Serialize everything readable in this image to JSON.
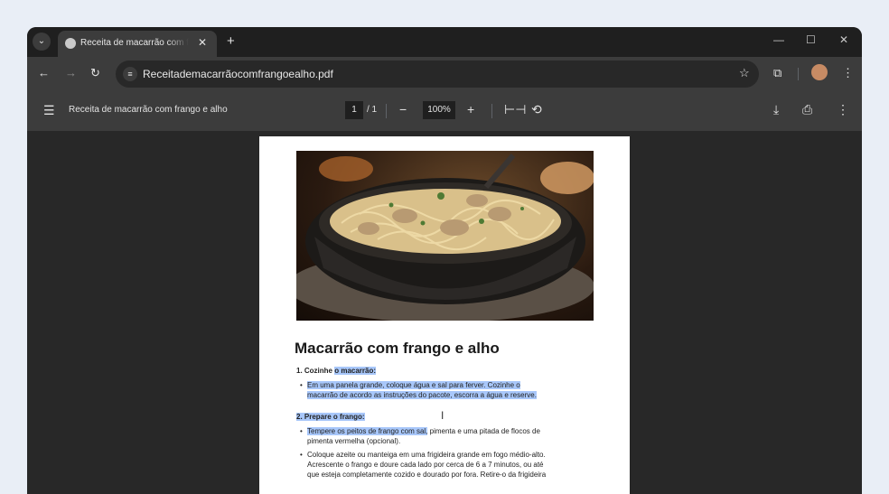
{
  "tab": {
    "title": "Receita de macarrão com frango e alho"
  },
  "address": {
    "url": "Receitademacarrãocomfrangoealho.pdf"
  },
  "pdf_toolbar": {
    "doc_title": "Receita de macarrão com frango e alho",
    "page_current": "1",
    "page_total": "/ 1",
    "zoom": "100%"
  },
  "document": {
    "heading": "Macarrão com frango e alho",
    "step1_prefix": "1. Cozinhe ",
    "step1_hl": "o macarrão:",
    "step1_b1_l1": "Em uma panela grande, coloque água e sal para ferver. Cozinhe o",
    "step1_b1_l2": "macarrão de acordo as instruções do pacote, escorra a água e reserve.",
    "step2_title": "2. Prepare o frango:",
    "step2_b1_hl": "Tempere os peitos de frango com sal,",
    "step2_b1_rest": " pimenta e uma pitada de flocos de",
    "step2_b1_l2": "pimenta vermelha (opcional).",
    "step2_b2_l1": "Coloque azeite ou manteiga em uma frigideira grande em fogo médio-alto.",
    "step2_b2_l2": "Acrescente o frango e doure cada lado por cerca de 6 a 7 minutos, ou até",
    "step2_b2_l3": "que esteja completamente cozido e dourado por fora. Retire-o da frigideira"
  },
  "icons": {
    "tab_search": "chevron-down-icon",
    "favicon": "globe-icon",
    "back": "arrow-left-icon",
    "forward": "arrow-right-icon",
    "reload": "reload-icon",
    "site_info": "tune-icon",
    "bookmark": "star-icon",
    "extensions": "puzzle-icon",
    "menu": "kebab-icon"
  },
  "colors": {
    "highlight": "#a8c7fa",
    "chrome_dark": "#3c3c3c",
    "viewer_bg": "#282828"
  }
}
